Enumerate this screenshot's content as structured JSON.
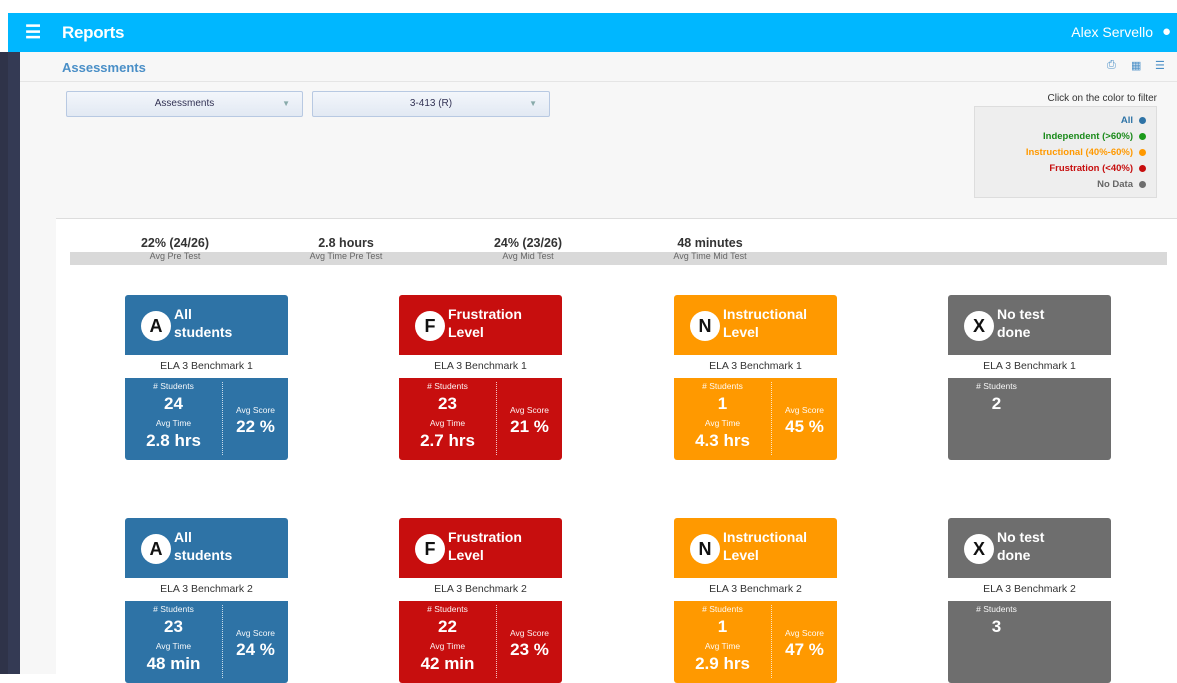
{
  "header": {
    "menu_icon": "hamburger-icon",
    "title": "Reports",
    "user_name": "Alex Servello",
    "user_icon": "user-icon"
  },
  "subheader": {
    "title": "Assessments",
    "tools": [
      "print-icon",
      "grid-view-icon",
      "list-view-icon"
    ]
  },
  "filters": [
    {
      "selected": "Assessments"
    },
    {
      "selected": "3-413 (R)"
    }
  ],
  "legend": {
    "title": "Click on the color to filter",
    "items": [
      {
        "label": "All",
        "color": "#2e73a6",
        "text_color": "#2e73a6"
      },
      {
        "label": "Independent (>60%)",
        "color": "#1a9a1a",
        "text_color": "#1a8a1a"
      },
      {
        "label": "Instructional (40%-60%)",
        "color": "#ff9900",
        "text_color": "#ff9900"
      },
      {
        "label": "Frustration (<40%)",
        "color": "#c70e0e",
        "text_color": "#c70e0e"
      },
      {
        "label": "No Data",
        "color": "#6e6e6e",
        "text_color": "#666666"
      }
    ]
  },
  "stats": [
    {
      "value": "22% (24/26)",
      "label": "Avg Pre Test"
    },
    {
      "value": "2.8 hours",
      "label": "Avg Time Pre Test"
    },
    {
      "value": "24% (23/26)",
      "label": "Avg Mid Test"
    },
    {
      "value": "48 minutes",
      "label": "Avg Time Mid Test"
    }
  ],
  "labels": {
    "students": "# Students",
    "avg_time": "Avg Time",
    "avg_score": "Avg Score"
  },
  "rows": [
    {
      "cards": [
        {
          "letter": "A",
          "title1": "All",
          "title2": "students",
          "benchmark": "ELA 3 Benchmark 1",
          "students": "24",
          "avg_time": "2.8 hrs",
          "avg_score": "22 %"
        },
        {
          "letter": "F",
          "title1": "Frustration",
          "title2": "Level",
          "benchmark": "ELA 3 Benchmark 1",
          "students": "23",
          "avg_time": "2.7 hrs",
          "avg_score": "21 %"
        },
        {
          "letter": "N",
          "title1": "Instructional",
          "title2": "Level",
          "benchmark": "ELA 3 Benchmark 1",
          "students": "1",
          "avg_time": "4.3 hrs",
          "avg_score": "45 %"
        },
        {
          "letter": "X",
          "title1": "No test",
          "title2": "done",
          "benchmark": "ELA 3 Benchmark 1",
          "students": "2"
        }
      ]
    },
    {
      "cards": [
        {
          "letter": "A",
          "title1": "All",
          "title2": "students",
          "benchmark": "ELA 3 Benchmark 2",
          "students": "23",
          "avg_time": "48 min",
          "avg_score": "24 %"
        },
        {
          "letter": "F",
          "title1": "Frustration",
          "title2": "Level",
          "benchmark": "ELA 3 Benchmark 2",
          "students": "22",
          "avg_time": "42 min",
          "avg_score": "23 %"
        },
        {
          "letter": "N",
          "title1": "Instructional",
          "title2": "Level",
          "benchmark": "ELA 3 Benchmark 2",
          "students": "1",
          "avg_time": "2.9 hrs",
          "avg_score": "47 %"
        },
        {
          "letter": "X",
          "title1": "No test",
          "title2": "done",
          "benchmark": "ELA 3 Benchmark 2",
          "students": "3"
        }
      ]
    }
  ]
}
